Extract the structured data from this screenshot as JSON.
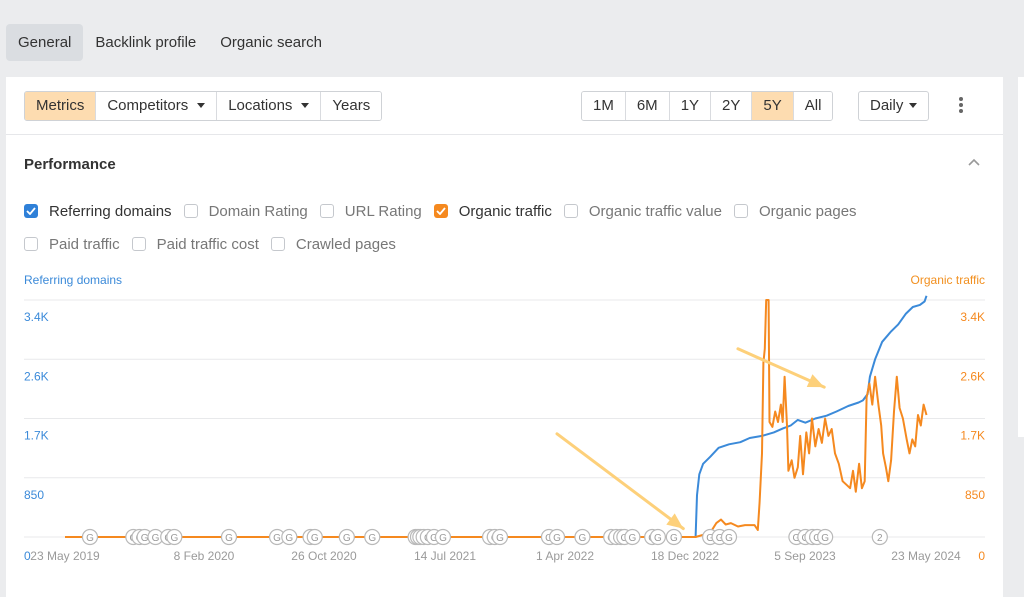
{
  "tabs": [
    {
      "label": "General",
      "active": true
    },
    {
      "label": "Backlink profile",
      "active": false
    },
    {
      "label": "Organic search",
      "active": false
    }
  ],
  "toolbar": {
    "left_group": [
      {
        "label": "Metrics",
        "selected": true,
        "dropdown": false
      },
      {
        "label": "Competitors",
        "selected": false,
        "dropdown": true
      },
      {
        "label": "Locations",
        "selected": false,
        "dropdown": true
      },
      {
        "label": "Years",
        "selected": false,
        "dropdown": false
      }
    ],
    "ranges": [
      {
        "label": "1M",
        "selected": false
      },
      {
        "label": "6M",
        "selected": false
      },
      {
        "label": "1Y",
        "selected": false
      },
      {
        "label": "2Y",
        "selected": false
      },
      {
        "label": "5Y",
        "selected": true
      },
      {
        "label": "All",
        "selected": false
      }
    ],
    "interval": {
      "label": "Daily"
    },
    "more_icon": "kebab-icon"
  },
  "performance": {
    "title": "Performance",
    "collapse_icon": "chevron-up-icon",
    "metrics": [
      [
        {
          "label": "Referring domains",
          "checked": true,
          "color": "#2f80d8"
        },
        {
          "label": "Domain Rating",
          "checked": false
        },
        {
          "label": "URL Rating",
          "checked": false
        },
        {
          "label": "Organic traffic",
          "checked": true,
          "color": "#f5891f"
        },
        {
          "label": "Organic traffic value",
          "checked": false
        },
        {
          "label": "Organic pages",
          "checked": false
        }
      ],
      [
        {
          "label": "Paid traffic",
          "checked": false
        },
        {
          "label": "Paid traffic cost",
          "checked": false
        },
        {
          "label": "Crawled pages",
          "checked": false
        }
      ]
    ]
  },
  "colors": {
    "referring": "#3b8ad9",
    "organic": "#f5891f",
    "arrow": "#fdd07a",
    "grid": "#e8e9eb",
    "tick": "#9a9a9a",
    "selected_bg": "#fddcb0"
  },
  "chart_data": {
    "type": "line",
    "title": "Performance",
    "x_ticks": [
      "23 May 2019",
      "8 Feb 2020",
      "26 Oct 2020",
      "14 Jul 2021",
      "1 Apr 2022",
      "18 Dec 2022",
      "5 Sep 2023",
      "23 May 2024"
    ],
    "x_range": [
      "2019-04-01",
      "2024-06-25"
    ],
    "y_left": {
      "label": "Referring domains",
      "ticks": [
        "0",
        "850",
        "1.7K",
        "2.6K",
        "3.4K"
      ],
      "tick_values": [
        0,
        850,
        1700,
        2550,
        3400
      ],
      "range": [
        0,
        3400
      ]
    },
    "y_right": {
      "label": "Organic traffic",
      "ticks": [
        "0",
        "850",
        "1.7K",
        "2.6K",
        "3.4K"
      ],
      "tick_values": [
        0,
        850,
        1700,
        2550,
        3400
      ],
      "range": [
        0,
        3400
      ]
    },
    "grid": true,
    "series": [
      {
        "name": "Referring domains",
        "axis": "left",
        "points": [
          [
            "2019-05-23",
            0
          ],
          [
            "2023-01-20",
            0
          ],
          [
            "2023-01-23",
            600
          ],
          [
            "2023-01-28",
            900
          ],
          [
            "2023-02-05",
            1050
          ],
          [
            "2023-02-20",
            1150
          ],
          [
            "2023-03-10",
            1280
          ],
          [
            "2023-04-01",
            1330
          ],
          [
            "2023-04-25",
            1360
          ],
          [
            "2023-05-15",
            1420
          ],
          [
            "2023-06-10",
            1450
          ],
          [
            "2023-07-05",
            1500
          ],
          [
            "2023-07-25",
            1560
          ],
          [
            "2023-08-10",
            1600
          ],
          [
            "2023-08-25",
            1680
          ],
          [
            "2023-09-10",
            1640
          ],
          [
            "2023-10-01",
            1700
          ],
          [
            "2023-10-25",
            1740
          ],
          [
            "2023-11-15",
            1800
          ],
          [
            "2023-12-10",
            1880
          ],
          [
            "2024-01-01",
            1930
          ],
          [
            "2024-01-10",
            1960
          ],
          [
            "2024-01-20",
            2050
          ],
          [
            "2024-01-25",
            2300
          ],
          [
            "2024-02-05",
            2550
          ],
          [
            "2024-02-20",
            2800
          ],
          [
            "2024-03-10",
            2950
          ],
          [
            "2024-03-25",
            3050
          ],
          [
            "2024-04-10",
            3200
          ],
          [
            "2024-04-25",
            3300
          ],
          [
            "2024-05-10",
            3330
          ],
          [
            "2024-05-20",
            3380
          ],
          [
            "2024-05-24",
            3460
          ]
        ]
      },
      {
        "name": "Organic traffic",
        "axis": "right",
        "points": [
          [
            "2019-05-23",
            0
          ],
          [
            "2023-01-20",
            0
          ],
          [
            "2023-02-05",
            30
          ],
          [
            "2023-02-20",
            60
          ],
          [
            "2023-03-05",
            200
          ],
          [
            "2023-03-15",
            250
          ],
          [
            "2023-03-25",
            180
          ],
          [
            "2023-04-05",
            200
          ],
          [
            "2023-04-20",
            150
          ],
          [
            "2023-05-05",
            170
          ],
          [
            "2023-05-25",
            170
          ],
          [
            "2023-06-01",
            100
          ],
          [
            "2023-06-05",
            500
          ],
          [
            "2023-06-10",
            1200
          ],
          [
            "2023-06-13",
            2500
          ],
          [
            "2023-06-16",
            2700
          ],
          [
            "2023-06-19",
            3400
          ],
          [
            "2023-06-24",
            3400
          ],
          [
            "2023-06-26",
            1650
          ],
          [
            "2023-07-02",
            1580
          ],
          [
            "2023-07-08",
            1800
          ],
          [
            "2023-07-14",
            1650
          ],
          [
            "2023-07-20",
            1900
          ],
          [
            "2023-07-24",
            1650
          ],
          [
            "2023-07-28",
            2300
          ],
          [
            "2023-08-02",
            1600
          ],
          [
            "2023-08-05",
            950
          ],
          [
            "2023-08-12",
            1100
          ],
          [
            "2023-08-18",
            850
          ],
          [
            "2023-08-25",
            1000
          ],
          [
            "2023-08-30",
            1450
          ],
          [
            "2023-09-05",
            900
          ],
          [
            "2023-09-12",
            1500
          ],
          [
            "2023-09-18",
            1200
          ],
          [
            "2023-09-24",
            1700
          ],
          [
            "2023-10-01",
            1300
          ],
          [
            "2023-10-08",
            1550
          ],
          [
            "2023-10-15",
            1350
          ],
          [
            "2023-10-22",
            1700
          ],
          [
            "2023-10-29",
            1450
          ],
          [
            "2023-11-05",
            1550
          ],
          [
            "2023-11-12",
            1200
          ],
          [
            "2023-11-20",
            1050
          ],
          [
            "2023-11-28",
            800
          ],
          [
            "2023-12-06",
            750
          ],
          [
            "2023-12-14",
            700
          ],
          [
            "2023-12-20",
            950
          ],
          [
            "2023-12-26",
            650
          ],
          [
            "2024-01-02",
            1050
          ],
          [
            "2024-01-08",
            700
          ],
          [
            "2024-01-14",
            800
          ],
          [
            "2024-01-18",
            2000
          ],
          [
            "2024-01-24",
            2200
          ],
          [
            "2024-01-30",
            1900
          ],
          [
            "2024-02-05",
            2300
          ],
          [
            "2024-02-12",
            1900
          ],
          [
            "2024-02-18",
            1600
          ],
          [
            "2024-02-22",
            1200
          ],
          [
            "2024-02-28",
            1000
          ],
          [
            "2024-03-04",
            800
          ],
          [
            "2024-03-10",
            1100
          ],
          [
            "2024-03-16",
            1800
          ],
          [
            "2024-03-22",
            2300
          ],
          [
            "2024-03-28",
            1850
          ],
          [
            "2024-04-04",
            1700
          ],
          [
            "2024-04-12",
            1400
          ],
          [
            "2024-04-18",
            1200
          ],
          [
            "2024-04-24",
            1400
          ],
          [
            "2024-04-30",
            1300
          ],
          [
            "2024-05-06",
            1750
          ],
          [
            "2024-05-12",
            1600
          ],
          [
            "2024-05-18",
            1900
          ],
          [
            "2024-05-24",
            1750
          ]
        ]
      }
    ],
    "annotations": {
      "google_update_markers": [
        "2019-07-15",
        "2019-10-15",
        "2019-10-28",
        "2019-11-08",
        "2019-12-01",
        "2019-12-28",
        "2020-01-10",
        "2020-05-05",
        "2020-08-15",
        "2020-09-10",
        "2020-10-25",
        "2020-11-03",
        "2021-01-10",
        "2021-03-05",
        "2021-06-05",
        "2021-06-10",
        "2021-06-15",
        "2021-06-22",
        "2021-07-01",
        "2021-07-14",
        "2021-08-02",
        "2021-11-10",
        "2021-11-20",
        "2021-12-01",
        "2022-03-15",
        "2022-04-01",
        "2022-05-25",
        "2022-07-25",
        "2022-08-05",
        "2022-08-15",
        "2022-08-22",
        "2022-09-08",
        "2022-10-20",
        "2022-11-01",
        "2022-12-05",
        "2023-02-20",
        "2023-03-12",
        "2023-04-01",
        "2023-08-22",
        "2023-09-10",
        "2023-09-25",
        "2023-10-05",
        "2023-10-22"
      ],
      "grouped_marker": {
        "date": "2024-02-15",
        "label": "2"
      },
      "marker_label": "G",
      "arrows": [
        {
          "from": [
            "2022-04-01",
            1480
          ],
          "to": [
            "2022-12-25",
            120
          ]
        },
        {
          "from": [
            "2023-04-20",
            2700
          ],
          "to": [
            "2023-10-20",
            2150
          ]
        }
      ]
    }
  }
}
